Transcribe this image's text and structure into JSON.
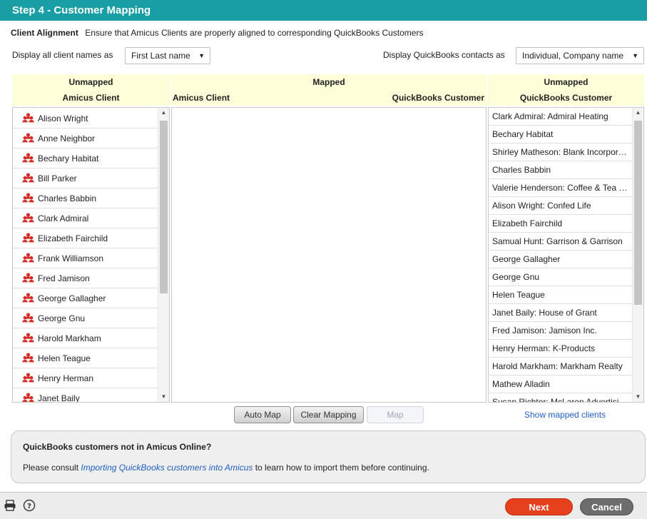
{
  "title": "Step 4 - Customer  Mapping",
  "alignment": {
    "label": "Client Alignment",
    "text": "Ensure that Amicus Clients are properly aligned to corresponding QuickBooks Customers"
  },
  "display_clients": {
    "label": "Display all client names as",
    "value": "First Last name"
  },
  "display_qb": {
    "label": "Display QuickBooks contacts as",
    "value": "Individual, Company name"
  },
  "headers": {
    "unmapped": "Unmapped",
    "amicus_client": "Amicus Client",
    "mapped": "Mapped",
    "qb_customer": "QuickBooks Customer"
  },
  "amicus_clients": [
    "Alison Wright",
    "Anne Neighbor",
    "Bechary Habitat",
    "Bill Parker",
    "Charles Babbin",
    "Clark Admiral",
    "Elizabeth Fairchild",
    "Frank Williamson",
    "Fred Jamison",
    "George Gallagher",
    "George Gnu",
    "Harold Markham",
    "Helen Teague",
    "Henry Herman",
    "Janet Baily"
  ],
  "qb_customers": [
    "Clark Admiral: Admiral Heating",
    "Bechary Habitat",
    "Shirley Matheson: Blank Incorporated",
    "Charles Babbin",
    "Valerie Henderson: Coffee & Tea Co",
    "Alison Wright: Confed Life",
    "Elizabeth Fairchild",
    "Samual Hunt: Garrison & Garrison",
    "George Gallagher",
    "George Gnu",
    "Helen Teague",
    "Janet Baily: House of Grant",
    "Fred Jamison: Jamison Inc.",
    "Henry Herman: K-Products",
    "Harold Markham: Markham Realty",
    "Mathew Alladin",
    "Susan Richter: McLaren Advertising"
  ],
  "buttons": {
    "auto_map": "Auto Map",
    "clear_mapping": "Clear Mapping",
    "map": "Map",
    "show_mapped": "Show mapped clients",
    "next": "Next",
    "cancel": "Cancel"
  },
  "info": {
    "title": "QuickBooks customers not in Amicus Online?",
    "pre": "Please consult ",
    "link": "Importing QuickBooks customers into Amicus",
    "post": " to learn how to import them before continuing."
  }
}
